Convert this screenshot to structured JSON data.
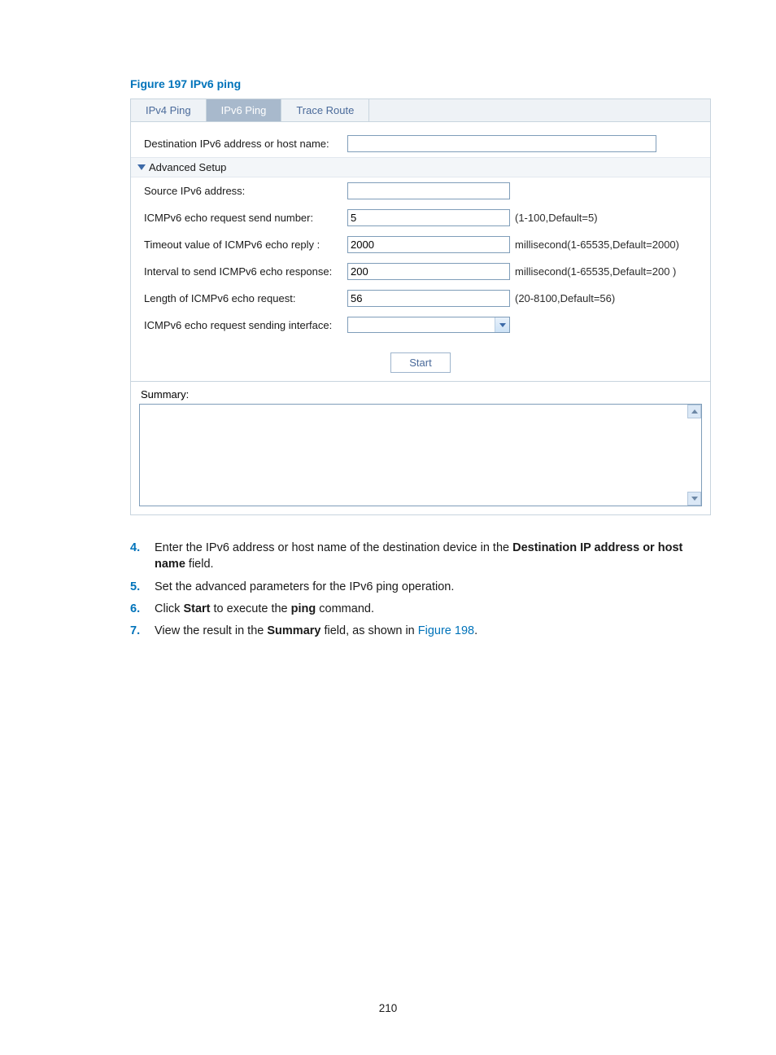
{
  "figure_title": "Figure 197 IPv6 ping",
  "tabs": {
    "ipv4": "IPv4 Ping",
    "ipv6": "IPv6 Ping",
    "trace": "Trace Route"
  },
  "form": {
    "dest_label": "Destination IPv6 address or host name:",
    "dest_value": "",
    "adv_toggle": "Advanced Setup",
    "src_label": "Source IPv6 address:",
    "src_value": "",
    "send_num_label": "ICMPv6 echo request send number:",
    "send_num_value": "5",
    "send_num_hint": "(1-100,Default=5)",
    "timeout_label": "Timeout value of ICMPv6 echo reply :",
    "timeout_value": "2000",
    "timeout_hint": "millisecond(1-65535,Default=2000)",
    "interval_label": "Interval to send ICMPv6 echo response:",
    "interval_value": "200",
    "interval_hint": "millisecond(1-65535,Default=200 )",
    "length_label": "Length of ICMPv6 echo request:",
    "length_value": "56",
    "length_hint": "(20-8100,Default=56)",
    "intf_label": "ICMPv6 echo request sending interface:",
    "intf_value": "",
    "start_label": "Start",
    "summary_label": "Summary:",
    "summary_value": ""
  },
  "steps": {
    "s4_num": "4.",
    "s4_a": "Enter the IPv6 address or host name of the destination device in the ",
    "s4_b": "Destination IP address or host name",
    "s4_c": " field.",
    "s5_num": "5.",
    "s5": "Set the advanced parameters for the IPv6 ping operation.",
    "s6_num": "6.",
    "s6_a": "Click ",
    "s6_b": "Start",
    "s6_c": " to execute the ",
    "s6_d": "ping",
    "s6_e": " command.",
    "s7_num": "7.",
    "s7_a": "View the result in the ",
    "s7_b": "Summary",
    "s7_c": " field, as shown in ",
    "s7_link": "Figure 198",
    "s7_d": "."
  },
  "page_number": "210"
}
